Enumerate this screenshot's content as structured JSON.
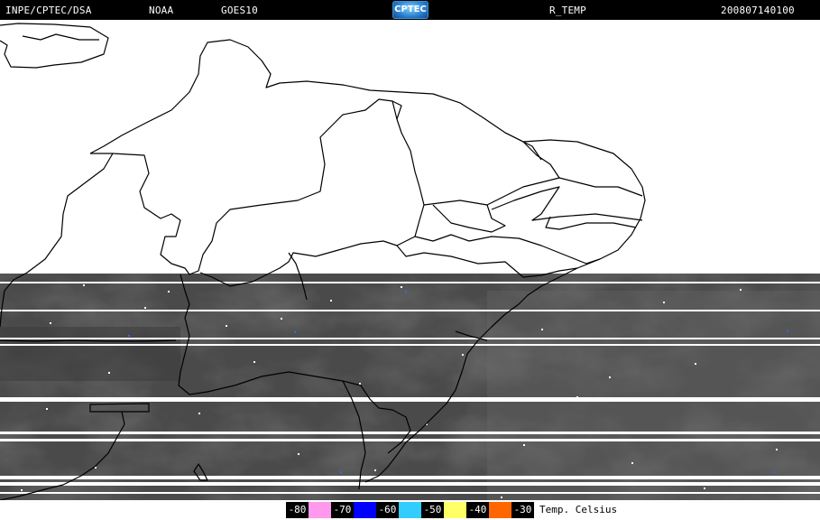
{
  "header": {
    "institution": "INPE/CPTEC/DSA",
    "agency": "NOAA",
    "satellite": "GOES10",
    "logo_text": "CPTEC",
    "product": "R_TEMP",
    "timestamp": "200807140100"
  },
  "legend": {
    "title": "Temp. Celsius",
    "items": [
      {
        "label": "-80",
        "color": "#ff99ee"
      },
      {
        "label": "-70",
        "color": "#0000ff"
      },
      {
        "label": "-60",
        "color": "#33ccff"
      },
      {
        "label": "-50",
        "color": "#ffff66"
      },
      {
        "label": "-40",
        "color": "#ff6600"
      },
      {
        "label": "-30",
        "color": ""
      }
    ]
  },
  "colors": {
    "background": "#ffffff",
    "header_bg": "#000000",
    "imagery_gray": "#4a4a4a",
    "border_lines": "#000000"
  }
}
